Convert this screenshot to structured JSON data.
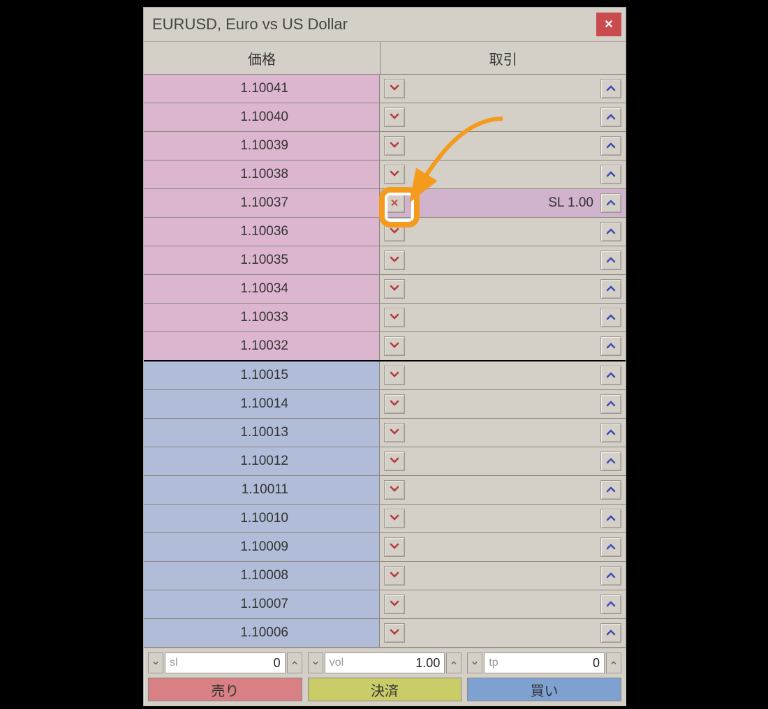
{
  "window": {
    "title": "EURUSD, Euro vs US Dollar"
  },
  "headers": {
    "price": "価格",
    "trade": "取引"
  },
  "rows": [
    {
      "price": "1.10041",
      "side": "ask",
      "highlight": false,
      "label": ""
    },
    {
      "price": "1.10040",
      "side": "ask",
      "highlight": false,
      "label": ""
    },
    {
      "price": "1.10039",
      "side": "ask",
      "highlight": false,
      "label": ""
    },
    {
      "price": "1.10038",
      "side": "ask",
      "highlight": false,
      "label": ""
    },
    {
      "price": "1.10037",
      "side": "ask",
      "highlight": true,
      "label": "SL 1.00",
      "cancel": true
    },
    {
      "price": "1.10036",
      "side": "ask",
      "highlight": false,
      "label": ""
    },
    {
      "price": "1.10035",
      "side": "ask",
      "highlight": false,
      "label": ""
    },
    {
      "price": "1.10034",
      "side": "ask",
      "highlight": false,
      "label": ""
    },
    {
      "price": "1.10033",
      "side": "ask",
      "highlight": false,
      "label": ""
    },
    {
      "price": "1.10032",
      "side": "ask",
      "highlight": false,
      "label": ""
    },
    {
      "price": "1.10015",
      "side": "bid",
      "highlight": false,
      "label": ""
    },
    {
      "price": "1.10014",
      "side": "bid",
      "highlight": false,
      "label": ""
    },
    {
      "price": "1.10013",
      "side": "bid",
      "highlight": false,
      "label": ""
    },
    {
      "price": "1.10012",
      "side": "bid",
      "highlight": false,
      "label": ""
    },
    {
      "price": "1.10011",
      "side": "bid",
      "highlight": false,
      "label": ""
    },
    {
      "price": "1.10010",
      "side": "bid",
      "highlight": false,
      "label": ""
    },
    {
      "price": "1.10009",
      "side": "bid",
      "highlight": false,
      "label": ""
    },
    {
      "price": "1.10008",
      "side": "bid",
      "highlight": false,
      "label": ""
    },
    {
      "price": "1.10007",
      "side": "bid",
      "highlight": false,
      "label": ""
    },
    {
      "price": "1.10006",
      "side": "bid",
      "highlight": false,
      "label": ""
    }
  ],
  "inputs": {
    "sl": {
      "label": "sl",
      "value": "0"
    },
    "vol": {
      "label": "vol",
      "value": "1.00"
    },
    "tp": {
      "label": "tp",
      "value": "0"
    }
  },
  "buttons": {
    "sell": "売り",
    "close": "決済",
    "buy": "買い"
  }
}
